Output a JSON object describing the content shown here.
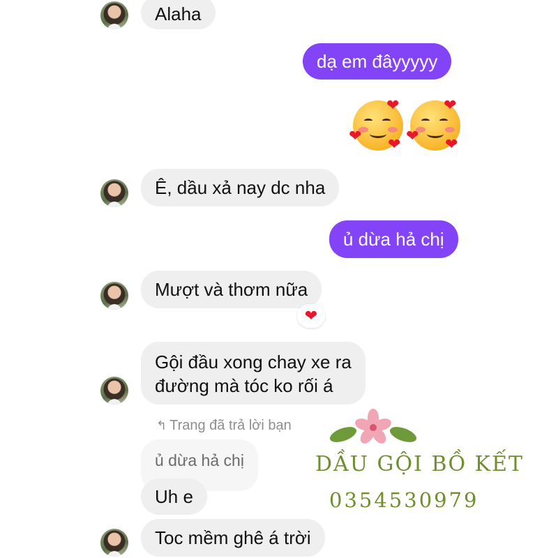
{
  "messages": {
    "m1": "Alaha",
    "m2": "dạ em đâyyyyy",
    "m3": "Ê, dầu xả nay dc nha",
    "m4": "ủ dừa hả chị",
    "m5": "Mượt và thơm nữa",
    "m6_line1": "Gội đầu xong chay xe ra",
    "m6_line2": "đường mà tóc ko rối á",
    "reply_label": "Trang đã trả lời bạn",
    "quoted": "ủ dừa hả chị",
    "m7": "Uh e",
    "m8": "Toc mềm ghê á trời"
  },
  "reaction": "❤",
  "reply_arrow": "↰",
  "watermark": {
    "name": "DẦU GỘI BỒ KẾT",
    "phone": "0354530979"
  },
  "colors": {
    "outgoing_bubble": "#8344f7",
    "incoming_bubble": "#efefef",
    "brand_green": "#6f8f2e",
    "heart_red": "#e8182c"
  },
  "icons": [
    "avatar",
    "smiling-face-with-hearts-emoji",
    "heart-reaction-icon",
    "reply-arrow-icon",
    "flower-leaves-logo"
  ]
}
